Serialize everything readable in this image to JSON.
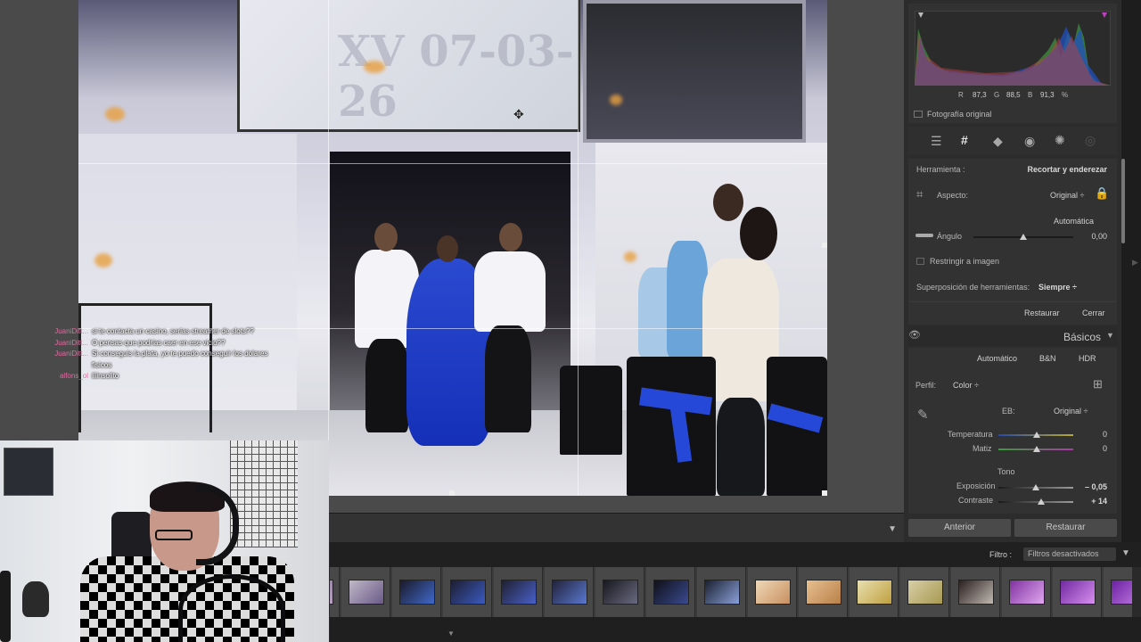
{
  "photo": {
    "screen_text": "XV 07-03-26"
  },
  "chat": [
    {
      "user": "JuaniDitt...",
      "message": "si te contacta un casino, serias streamer de slots??"
    },
    {
      "user": "JuaniDitt...",
      "message": "O pensas que podrias caer en ese vicio??"
    },
    {
      "user": "JuaniDitt...",
      "message": "Si conseguis la plata, yo te puedo conseguir los dolares fisicos"
    },
    {
      "user": "alfons_ol",
      "message": "iiiinsolito"
    }
  ],
  "histogram": {
    "r_label": "R",
    "r_value": "87,3",
    "g_label": "G",
    "g_value": "88,5",
    "b_label": "B",
    "b_value": "91,3",
    "unit": "%",
    "original_photo_label": "Fotografía original"
  },
  "tools": [
    "sliders-icon",
    "crop-icon",
    "eraser-icon",
    "red-eye-icon",
    "radial-icon",
    "mask-icon"
  ],
  "crop": {
    "tool_label": "Herramienta :",
    "tool_value": "Recortar y enderezar",
    "aspect_label": "Aspecto:",
    "aspect_value": "Original ÷",
    "auto_label": "Automática",
    "angle_label": "Ángulo",
    "angle_value": "0,00",
    "constrain_label": "Restringir a imagen",
    "overlay_label": "Superposición de herramientas:",
    "overlay_value": "Siempre ÷",
    "reset_label": "Restaurar",
    "close_label": "Cerrar"
  },
  "basic": {
    "title": "Básicos",
    "modes": [
      "Automático",
      "B&N",
      "HDR"
    ],
    "profile_label": "Perfil:",
    "profile_value": "Color ÷",
    "wb_label": "EB:",
    "wb_value": "Original ÷",
    "temp_label": "Temperatura",
    "temp_value": "0",
    "tint_label": "Matiz",
    "tint_value": "0",
    "tone_label": "Tono",
    "exposure_label": "Exposición",
    "exposure_value": "– 0,05",
    "contrast_label": "Contraste",
    "contrast_value": "+ 14"
  },
  "footer_buttons": {
    "prev": "Anterior",
    "reset": "Restaurar"
  },
  "filter": {
    "label": "Filtro :",
    "value": "Filtros desactivados"
  },
  "colors": {
    "accent_blue": "#2648d8",
    "panel_bg": "#2c2c2c",
    "chat_user": "#e06aa0"
  }
}
